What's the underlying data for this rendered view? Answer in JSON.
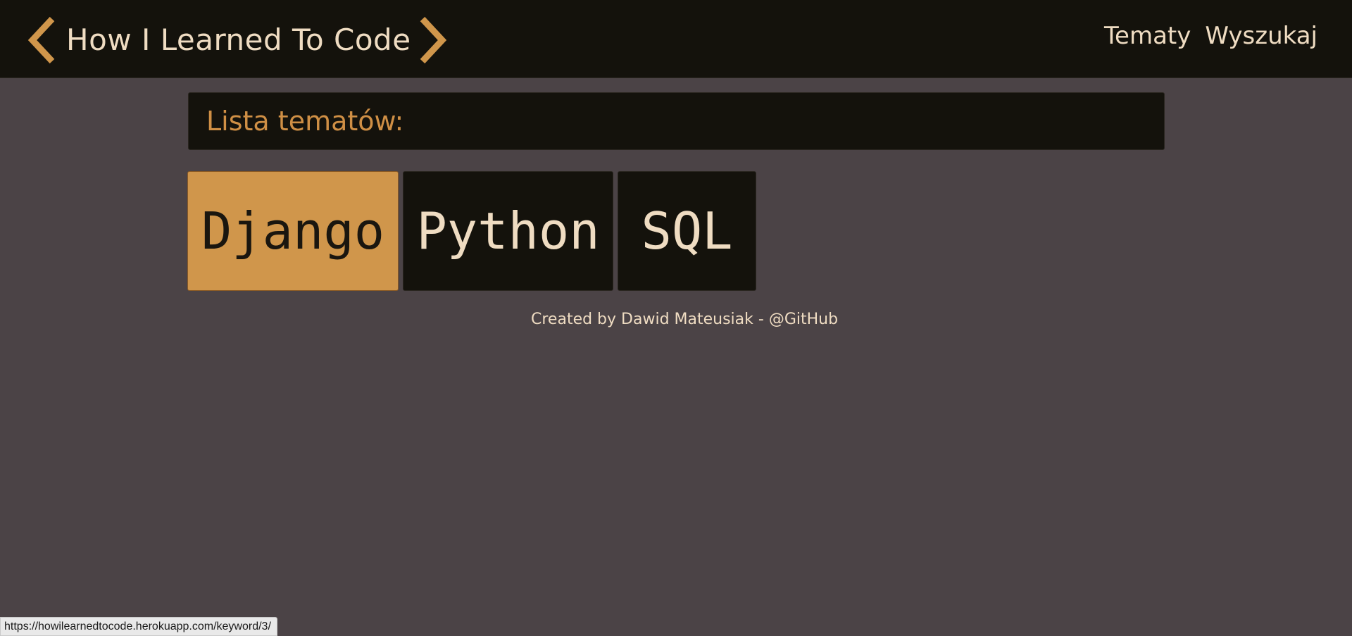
{
  "header": {
    "title": "How I Learned To Code",
    "nav": [
      {
        "label": "Tematy"
      },
      {
        "label": "Wyszukaj"
      }
    ]
  },
  "topics": {
    "heading": "Lista tematów:",
    "items": [
      {
        "label": "Django",
        "active": true
      },
      {
        "label": "Python",
        "active": false
      },
      {
        "label": "SQL",
        "active": false
      }
    ]
  },
  "footer": {
    "text": "Created by Dawid Mateusiak - ",
    "link": "@GitHub"
  },
  "status_bar": {
    "url": "https://howilearnedtocode.herokuapp.com/keyword/3/"
  },
  "colors": {
    "page_bg": "#4b4346",
    "panel_bg": "#14120c",
    "accent": "#d0964b",
    "text_light": "#efdcc2",
    "heading_orange": "#cf8f45"
  },
  "icons": {
    "brand_left": "chevron-left-icon",
    "brand_right": "chevron-right-icon"
  }
}
